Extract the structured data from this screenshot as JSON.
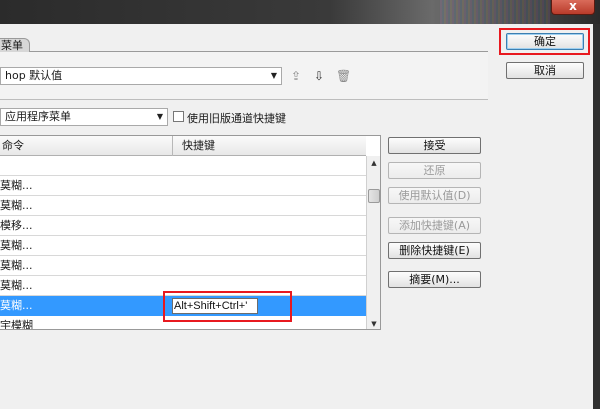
{
  "window": {
    "close_label": "x"
  },
  "tab": {
    "label": "菜单"
  },
  "preset": {
    "value": "hop 默认值"
  },
  "shortcuts_for": {
    "value": "应用程序菜单",
    "legacy_checkbox_label": "使用旧版通道快捷键",
    "legacy_checked": false
  },
  "table": {
    "headers": {
      "command": "命令",
      "shortcut": "快捷键"
    },
    "rows": [
      {
        "command": ""
      },
      {
        "command": "莫糊..."
      },
      {
        "command": "莫糊..."
      },
      {
        "command": "模移..."
      },
      {
        "command": "莫糊..."
      },
      {
        "command": "莫糊..."
      },
      {
        "command": "莫糊..."
      },
      {
        "command": "莫糊...",
        "selected": true,
        "shortcut_value": "Alt+Shift+Ctrl+'"
      },
      {
        "command": "宇模糊"
      }
    ]
  },
  "side_buttons": {
    "accept": "接受",
    "undo": "还原",
    "use_default": "使用默认值(D)",
    "add_shortcut": "添加快捷键(A)",
    "delete_shortcut": "删除快捷键(E)",
    "summarize": "摘要(M)..."
  },
  "dialog_buttons": {
    "ok": "确定",
    "cancel": "取消"
  },
  "colors": {
    "selection": "#3399ff",
    "highlight": "#e8191f"
  },
  "icons": [
    "save-preset-icon",
    "new-preset-icon",
    "delete-preset-icon",
    "dropdown-arrow-icon"
  ]
}
